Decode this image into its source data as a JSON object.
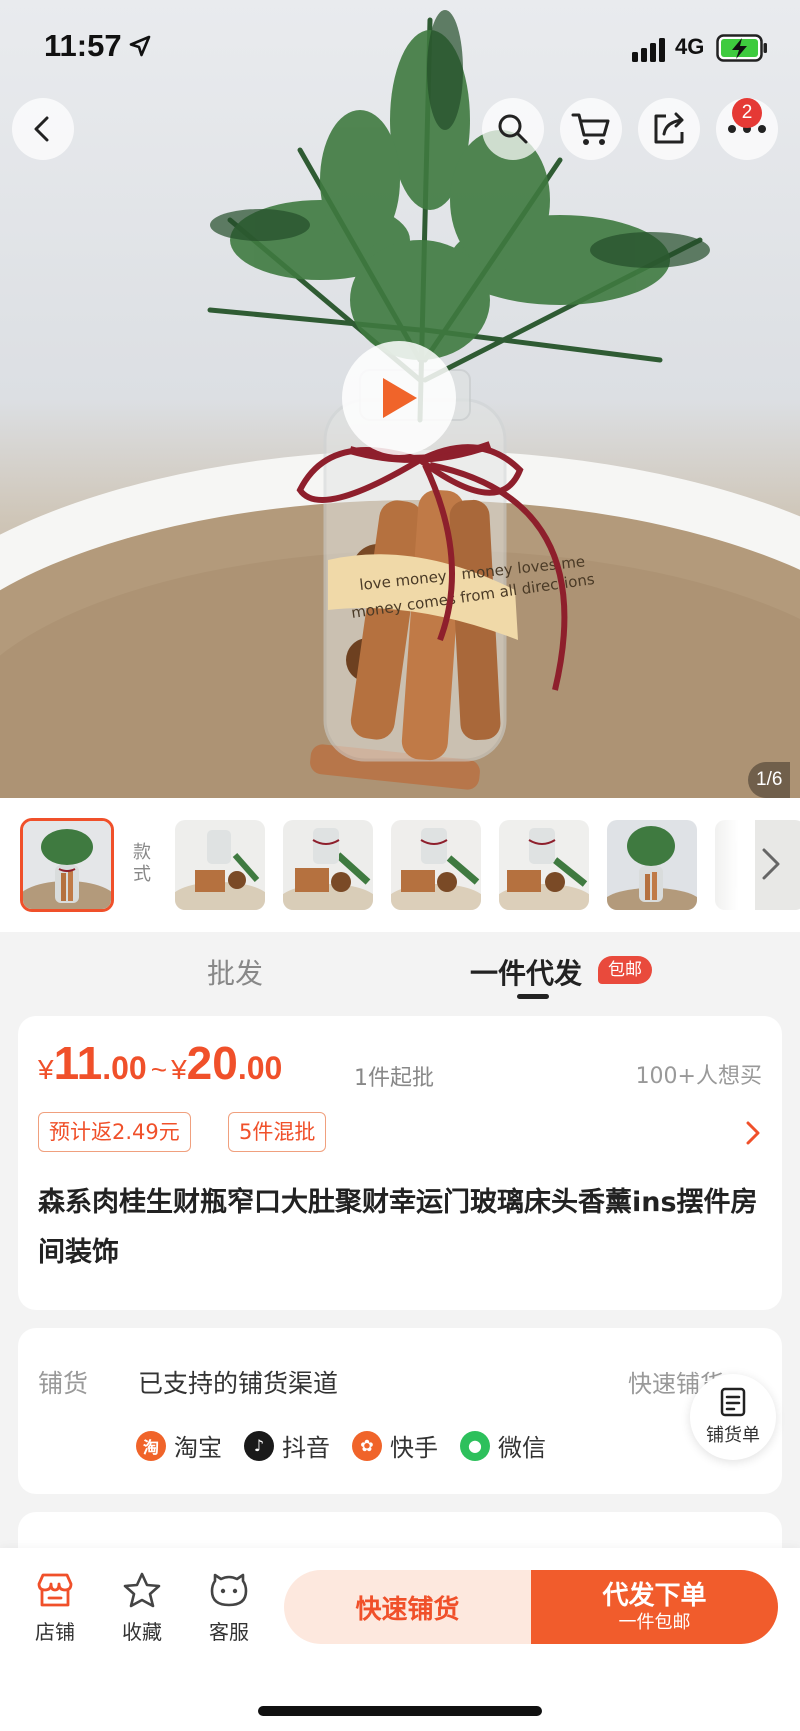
{
  "status_bar": {
    "time": "11:57",
    "network": "4G"
  },
  "hero": {
    "page_counter": "1/6",
    "cart_badge": "2",
    "label_text": [
      "love money，money loves me",
      "money comes from all directions"
    ]
  },
  "thumbnails": {
    "style_label": "款式"
  },
  "tabs": {
    "wholesale": "批发",
    "dropship": "一件代发",
    "dropship_badge": "包邮"
  },
  "price": {
    "currency": "¥",
    "low_int": "11",
    "low_dec": ".00",
    "tilde": "~",
    "high_int": "20",
    "high_dec": ".00",
    "moq": "1件起批",
    "want": "100+人想买",
    "tag_rebate": "预计返2.49元",
    "tag_mix": "5件混批",
    "title": "森系肉桂生财瓶窄口大肚聚财幸运门玻璃床头香薰ins摆件房间装饰"
  },
  "distribution": {
    "label": "铺货",
    "text": "已支持的铺货渠道",
    "quick_link": "快速铺货",
    "channels": [
      {
        "name": "淘宝",
        "glyph": "淘",
        "color": "#f0642a"
      },
      {
        "name": "抖音",
        "glyph": "♪",
        "color": "#1a1a1a"
      },
      {
        "name": "快手",
        "glyph": "✿",
        "color": "#f0642a"
      },
      {
        "name": "微信",
        "glyph": "●",
        "color": "#2dc05c"
      }
    ],
    "float_label": "铺货单"
  },
  "bottom_bar": {
    "store": "店铺",
    "favorite": "收藏",
    "service": "客服",
    "quick_btn": "快速铺货",
    "order_btn": "代发下单",
    "order_sub": "一件包邮"
  },
  "colors": {
    "accent": "#f0502a",
    "order_button": "#f15c2c",
    "quick_button_bg": "#fde8de"
  }
}
